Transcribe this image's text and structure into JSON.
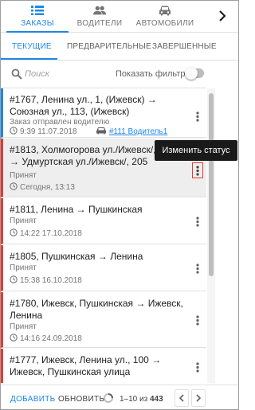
{
  "nav": {
    "tabs": [
      {
        "label": "ЗАКАЗЫ",
        "icon": "list-icon"
      },
      {
        "label": "ВОДИТЕЛИ",
        "icon": "people-icon"
      },
      {
        "label": "АВТОМОБИЛИ",
        "icon": "car-icon"
      }
    ],
    "active_color": "#1e88e5"
  },
  "subtabs": [
    "ТЕКУЩИЕ",
    "ПРЕДВАРИТЕЛЬНЫЕ",
    "ЗАВЕРШЕННЫЕ"
  ],
  "search": {
    "placeholder": "Поиск"
  },
  "filter": {
    "label": "Показать фильтр",
    "enabled": false
  },
  "orders": [
    {
      "title": "#1767, Ленина ул., 1, (Ижевск) → Союзная ул., 113, (Ижевск)",
      "status": "Заказ отправлен водителю",
      "time": "9:39 11.07.2018",
      "driver": "#111 Водитель1",
      "accent": "#1e88e5"
    },
    {
      "title": "#1813, Холмогорова ул./Ижевск/, 11 → Удмуртская ул./Ижевск/, 205",
      "status": "Принят",
      "time": "Сегодня, 13:13",
      "accent": "#e53935"
    },
    {
      "title": "#1811, Ленина → Пушкинская",
      "status": "Принят",
      "time": "14:22 17.10.2018",
      "accent": "#e53935"
    },
    {
      "title": "#1805, Пушкинская → Ленина",
      "status": "Принят",
      "time": "15:38 16.10.2018",
      "accent": "#e53935"
    },
    {
      "title": "#1780, Ижевск, Пушкинская → Ижевск, Ленина",
      "status": "Принят",
      "time": "14:16 24.09.2018",
      "accent": "#e53935"
    },
    {
      "title": "#1777, Ижевск, Ленина ул., 100 → Ижевск, Пушкинская улица",
      "status": "Принят",
      "accent": "#e53935"
    }
  ],
  "tooltip": "Изменить статус",
  "footer": {
    "add_label": "ДОБАВИТЬ",
    "refresh_label": "ОБНОВИТЬ",
    "range": "1–10 из",
    "total": "443"
  }
}
